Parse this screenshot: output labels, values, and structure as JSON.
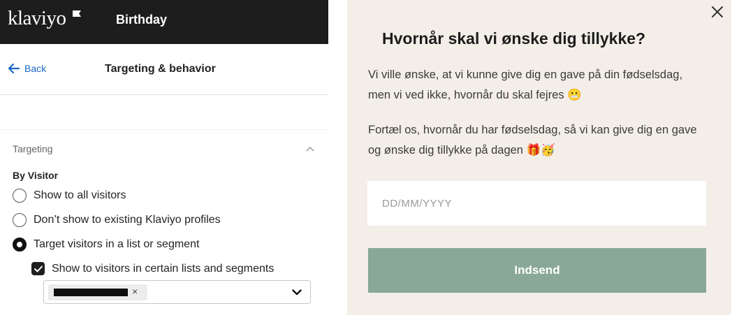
{
  "editor": {
    "brand": "klaviyo",
    "form_name": "Birthday",
    "back_label": "Back",
    "page_title": "Targeting & behavior",
    "section_title": "Targeting",
    "group_label": "By Visitor",
    "radio_options": [
      {
        "label": "Show to all visitors",
        "selected": false
      },
      {
        "label": "Don’t show to existing Klaviyo profiles",
        "selected": false
      },
      {
        "label": "Target visitors in a list or segment",
        "selected": true
      }
    ],
    "checkbox": {
      "label": "Show to visitors in certain lists and segments",
      "checked": true
    },
    "selected_tag_remove": "×",
    "icons": {
      "back": "arrow-left-icon",
      "collapse": "chevron-up-icon",
      "dropdown": "chevron-down-icon",
      "checkbox": "check-icon"
    }
  },
  "popup": {
    "title": "Hvornår skal vi ønske dig tillykke?",
    "paragraph1": "Vi ville ønske, at vi kunne give dig en gave på din fødselsdag, men vi ved ikke, hvornår du skal fejres 😬",
    "paragraph2": "Fortæl os, hvornår du har fødselsdag, så vi kan give dig en gave og ønske dig tillykke på dagen 🎁🥳",
    "date_placeholder": "DD/MM/YYYY",
    "submit_label": "Indsend",
    "close_icon": "close-icon"
  },
  "colors": {
    "topbar": "#1d1d1d",
    "link": "#1a67c6",
    "popup_bg": "#f3efe8",
    "button": "#8aa897"
  }
}
